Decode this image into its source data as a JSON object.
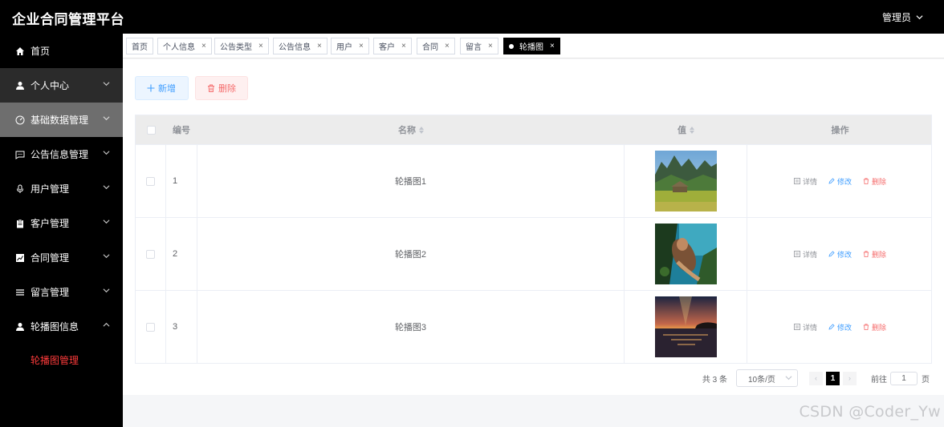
{
  "header": {
    "title": "企业合同管理平台",
    "user": "管理员"
  },
  "sidebar": {
    "items": [
      {
        "label": "首页",
        "icon": "home-icon"
      },
      {
        "label": "个人中心",
        "icon": "user-icon"
      },
      {
        "label": "基础数据管理",
        "icon": "gauge-icon"
      },
      {
        "label": "公告信息管理",
        "icon": "message-icon"
      },
      {
        "label": "用户管理",
        "icon": "microphone-icon"
      },
      {
        "label": "客户管理",
        "icon": "clipboard-icon"
      },
      {
        "label": "合同管理",
        "icon": "chart-icon"
      },
      {
        "label": "留言管理",
        "icon": "list-icon"
      },
      {
        "label": "轮播图信息",
        "icon": "user-icon"
      }
    ],
    "subitem": "轮播图管理"
  },
  "tabs": [
    {
      "label": "首页"
    },
    {
      "label": "个人信息",
      "close": "×"
    },
    {
      "label": "公告类型",
      "close": "×"
    },
    {
      "label": "公告信息",
      "close": "×"
    },
    {
      "label": "用户",
      "close": "×"
    },
    {
      "label": "客户",
      "close": "×"
    },
    {
      "label": "合同",
      "close": "×"
    },
    {
      "label": "留言",
      "close": "×"
    },
    {
      "label": "轮播图",
      "close": "×",
      "active": true
    }
  ],
  "toolbar": {
    "add": "新增",
    "delete": "删除"
  },
  "table": {
    "headers": {
      "id": "编号",
      "name": "名称",
      "value": "值",
      "actions": "操作"
    },
    "rows": [
      {
        "id": "1",
        "name": "轮播图1",
        "image": "landscape-village"
      },
      {
        "id": "2",
        "name": "轮播图2",
        "image": "underwater-diver"
      },
      {
        "id": "3",
        "name": "轮播图3",
        "image": "sunset-sea"
      }
    ],
    "actions": {
      "detail": "详情",
      "edit": "修改",
      "remove": "删除"
    }
  },
  "pagination": {
    "total": "共 3 条",
    "page_size": "10条/页",
    "prev": "‹",
    "current": "1",
    "next": "›",
    "goto": "前往",
    "goto_value": "1",
    "unit": "页"
  },
  "watermark": "CSDN @Coder_Yw",
  "colors": {
    "accent_active": "#ff3b3b",
    "primary": "#409eff",
    "danger": "#f56c6c",
    "sidebar_bg": "#000000"
  }
}
